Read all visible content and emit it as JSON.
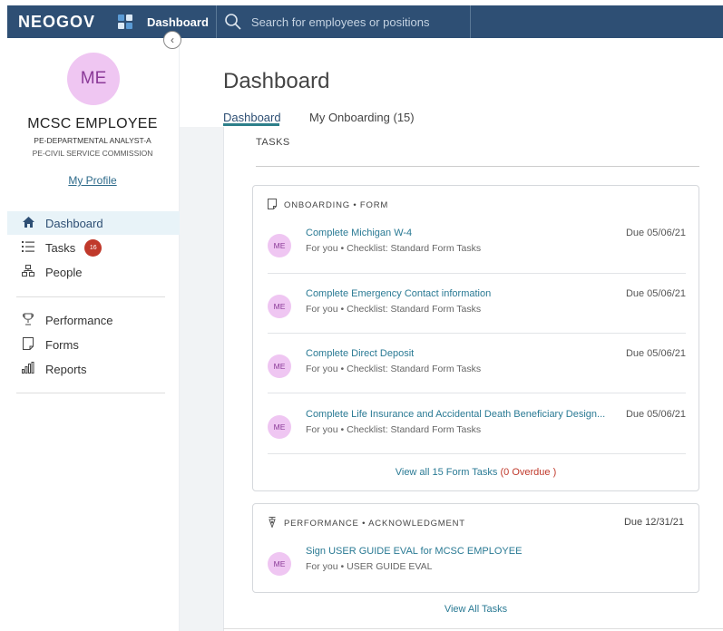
{
  "topbar": {
    "logo": "NEOGOV",
    "app_label": "Dashboard",
    "search_placeholder": "Search for employees or positions"
  },
  "profile": {
    "initials": "ME",
    "name": "MCSC EMPLOYEE",
    "title": "PE-DEPARTMENTAL ANALYST-A",
    "department": "PE-CIVIL SERVICE COMMISSION",
    "profile_link": "My Profile"
  },
  "sidebar": {
    "items": [
      {
        "label": "Dashboard",
        "icon": "home-icon"
      },
      {
        "label": "Tasks",
        "icon": "list-icon",
        "badge": "16"
      },
      {
        "label": "People",
        "icon": "org-chart-icon"
      },
      {
        "label": "Performance",
        "icon": "trophy-icon"
      },
      {
        "label": "Forms",
        "icon": "document-icon"
      },
      {
        "label": "Reports",
        "icon": "bar-chart-icon"
      }
    ]
  },
  "main": {
    "page_title": "Dashboard",
    "tabs": [
      {
        "label": "Dashboard",
        "active": true
      },
      {
        "label": "My Onboarding (15)",
        "active": false
      }
    ],
    "tasks_heading": "TASKS",
    "onboarding_card": {
      "header": "ONBOARDING • FORM",
      "tasks": [
        {
          "initials": "ME",
          "title": "Complete Michigan W-4",
          "subtitle": "For you • Checklist: Standard Form Tasks",
          "due": "Due 05/06/21"
        },
        {
          "initials": "ME",
          "title": "Complete Emergency Contact information",
          "subtitle": "For you • Checklist: Standard Form Tasks",
          "due": "Due 05/06/21"
        },
        {
          "initials": "ME",
          "title": "Complete Direct Deposit",
          "subtitle": "For you • Checklist: Standard Form Tasks",
          "due": "Due 05/06/21"
        },
        {
          "initials": "ME",
          "title": "Complete Life Insurance and Accidental Death Beneficiary Design...",
          "subtitle": "For you • Checklist: Standard Form Tasks",
          "due": "Due 05/06/21"
        }
      ],
      "view_all": "View all 15 Form Tasks",
      "overdue": "(0 Overdue )"
    },
    "performance_card": {
      "header": "PERFORMANCE • ACKNOWLEDGMENT",
      "due": "Due 12/31/21",
      "task": {
        "initials": "ME",
        "title": "Sign USER GUIDE EVAL for MCSC EMPLOYEE",
        "subtitle": "For you • USER GUIDE EVAL"
      }
    },
    "view_all_tasks": "View All Tasks"
  },
  "colors": {
    "topbar": "#2e4f74",
    "avatar_bg": "#efc6f2",
    "avatar_text": "#8b3a98",
    "link": "#2a7a94",
    "badge": "#c0392b"
  }
}
